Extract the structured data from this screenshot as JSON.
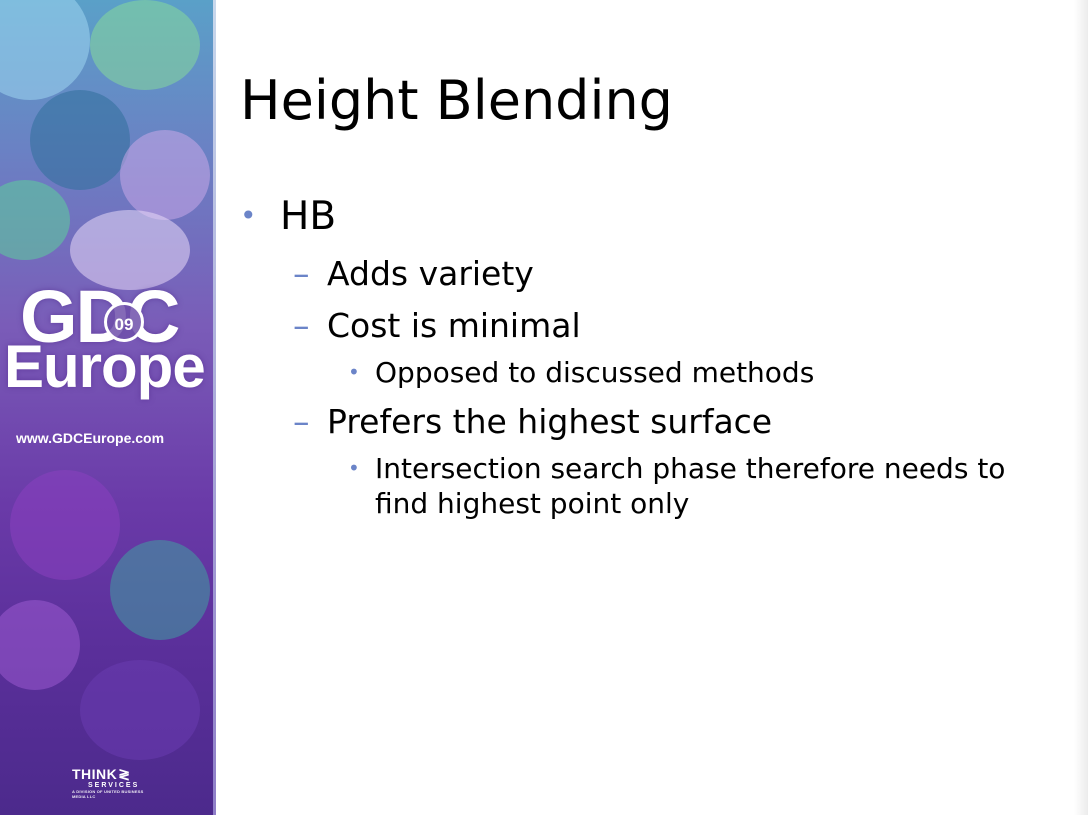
{
  "slide": {
    "title": "Height Blending",
    "bullets": [
      {
        "marker": "•",
        "text": "HB"
      },
      {
        "marker": "–",
        "text": "Adds variety"
      },
      {
        "marker": "–",
        "text": "Cost is minimal"
      },
      {
        "marker": "•",
        "text": "Opposed to discussed methods"
      },
      {
        "marker": "–",
        "text": "Prefers the highest surface"
      },
      {
        "marker": "•",
        "text": "Intersection search phase therefore needs to find highest point only"
      }
    ]
  },
  "banner": {
    "logo_gdc": "GDC",
    "logo_year": "09",
    "logo_europe": "Europe",
    "url": "www.GDCEurope.com",
    "sponsor_main": "THINK",
    "sponsor_sub": "SERVICES",
    "sponsor_tagline": "A DIVISION OF UNITED BUSINESS MEDIA LLC"
  },
  "colors": {
    "bullet_marker": "#6b84c8",
    "banner_top": "#5aa0c8",
    "banner_bottom": "#4c2a8c"
  }
}
